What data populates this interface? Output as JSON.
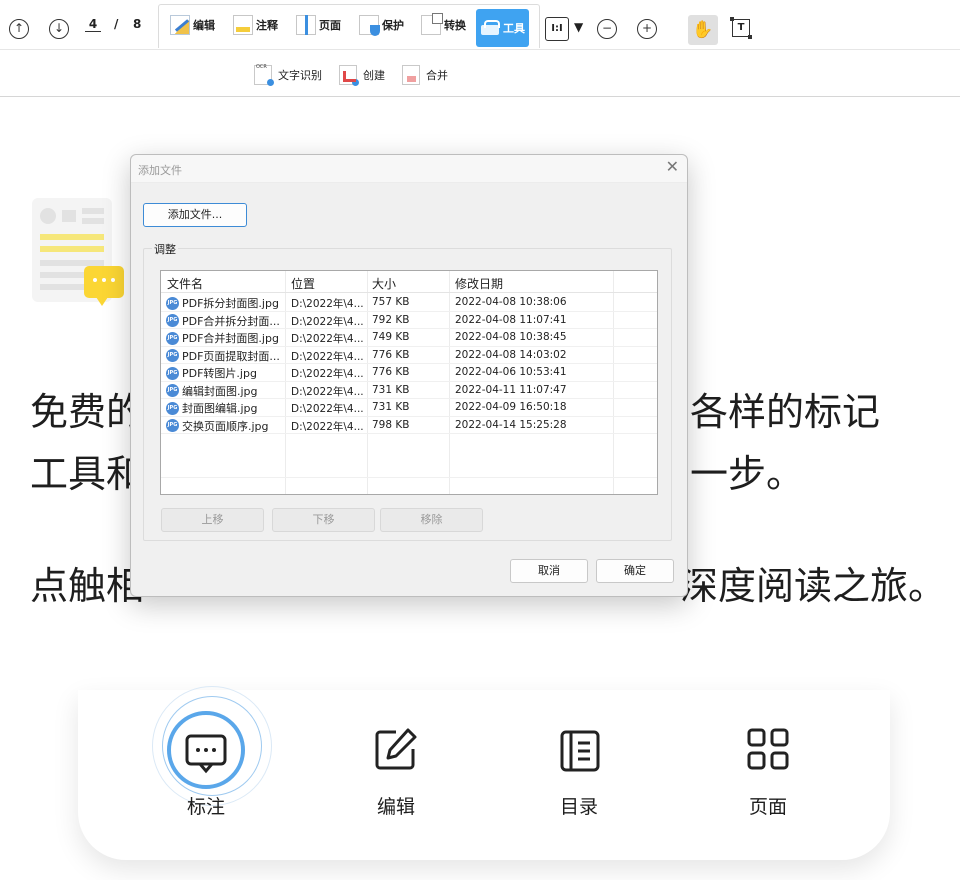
{
  "toolbar": {
    "prev_page_glyph": "↑",
    "next_page_glyph": "↓",
    "page_current": "4",
    "page_sep": "/",
    "page_total": "8",
    "edit_label": "编辑",
    "annotate_label": "注释",
    "page_label": "页面",
    "protect_label": "保护",
    "convert_label": "转换",
    "tools_label": "工具",
    "fit_glyph": "I:I",
    "fit_caret": "▼",
    "zoom_out_glyph": "−",
    "zoom_in_glyph": "+",
    "hand_glyph": "✋",
    "select_glyph": "T"
  },
  "subtoolbar": {
    "ocr_label": "文字识别",
    "create_label": "创建",
    "merge_label": "合并"
  },
  "document": {
    "line1_left": "免费的",
    "line1_right": "各样的标记",
    "line2_left": "工具和",
    "line2_right": "一步。",
    "line3_left": "点触相",
    "line3_right": "深度阅读之旅。"
  },
  "bottom_nav": {
    "annotate": "标注",
    "edit": "编辑",
    "toc": "目录",
    "pages": "页面"
  },
  "dialog": {
    "title": "添加文件",
    "close_glyph": "✕",
    "add_files_button": "添加文件...",
    "group_label": "调整",
    "columns": [
      "文件名",
      "位置",
      "大小",
      "修改日期"
    ],
    "file_icon_text": "JPG",
    "files": [
      {
        "name": "PDF拆分封面图.jpg",
        "location": "D:\\2022年\\4...",
        "size": "757 KB",
        "date": "2022-04-08 10:38:06"
      },
      {
        "name": "PDF合并拆分封面...",
        "location": "D:\\2022年\\4...",
        "size": "792 KB",
        "date": "2022-04-08 11:07:41"
      },
      {
        "name": "PDF合并封面图.jpg",
        "location": "D:\\2022年\\4...",
        "size": "749 KB",
        "date": "2022-04-08 10:38:45"
      },
      {
        "name": "PDF页面提取封面...",
        "location": "D:\\2022年\\4...",
        "size": "776 KB",
        "date": "2022-04-08 14:03:02"
      },
      {
        "name": "PDF转图片.jpg",
        "location": "D:\\2022年\\4...",
        "size": "776 KB",
        "date": "2022-04-06 10:53:41"
      },
      {
        "name": "编辑封面图.jpg",
        "location": "D:\\2022年\\4...",
        "size": "731 KB",
        "date": "2022-04-11 11:07:47"
      },
      {
        "name": "封面图编辑.jpg",
        "location": "D:\\2022年\\4...",
        "size": "731 KB",
        "date": "2022-04-09 16:50:18"
      },
      {
        "name": "交换页面顺序.jpg",
        "location": "D:\\2022年\\4...",
        "size": "798 KB",
        "date": "2022-04-14 15:25:28"
      }
    ],
    "move_up_button": "上移",
    "move_down_button": "下移",
    "remove_button": "移除",
    "cancel_button": "取消",
    "ok_button": "确定"
  },
  "colors": {
    "accent": "#3fa3f1",
    "ring": "#5aa7ea",
    "primary_border": "#3d8bd6"
  }
}
